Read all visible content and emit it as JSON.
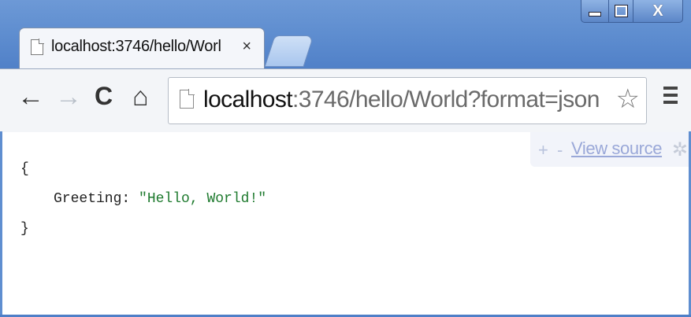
{
  "window": {
    "minimize_icon": "minimize-icon",
    "maximize_icon": "maximize-icon",
    "close_glyph": "X"
  },
  "tab": {
    "title": "localhost:3746/hello/Worl",
    "close_glyph": "×"
  },
  "toolbar": {
    "back_glyph": "←",
    "forward_glyph": "→",
    "reload_glyph": "C",
    "home_glyph": "⌂"
  },
  "omnibox": {
    "host": "localhost",
    "rest": ":3746/hello/World?format=json",
    "star_glyph": "☆"
  },
  "viewer": {
    "plus": "+",
    "minus": "-",
    "view_source": "View source",
    "gear_glyph": "✲"
  },
  "json_body": {
    "open_brace": "{",
    "key": "Greeting: ",
    "value": "\"Hello, World!\"",
    "close_brace": "}"
  },
  "colors": {
    "frame": "#5f8ed0",
    "string_value": "#1e7a2e",
    "link": "#9aa8d8"
  }
}
